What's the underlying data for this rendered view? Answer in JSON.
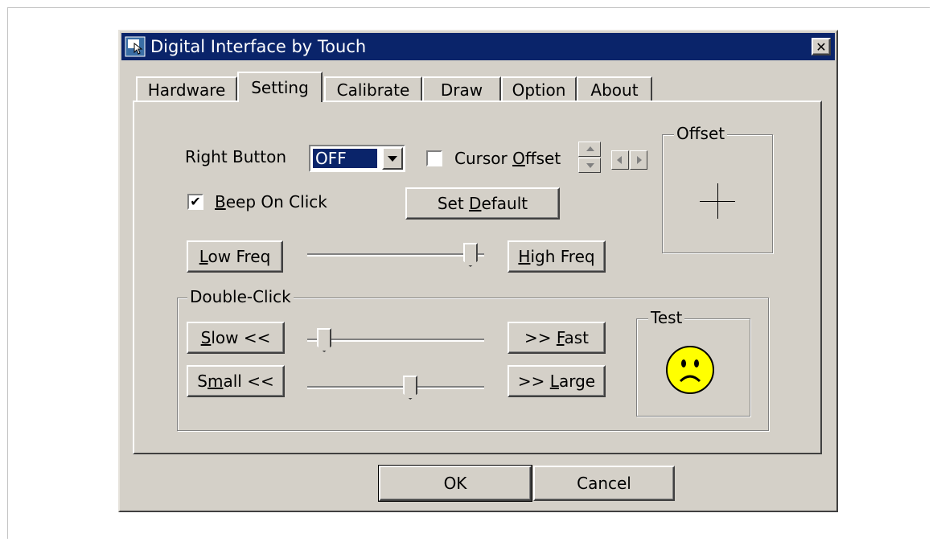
{
  "window": {
    "title": "Digital Interface by Touch",
    "close_label": "✕"
  },
  "tabs": [
    {
      "label": "Hardware",
      "active": false
    },
    {
      "label": "Setting",
      "active": true
    },
    {
      "label": "Calibrate",
      "active": false
    },
    {
      "label": "Draw",
      "active": false
    },
    {
      "label": "Option",
      "active": false
    },
    {
      "label": "About",
      "active": false
    }
  ],
  "setting": {
    "right_button_label": "Right Button",
    "right_button_value": "OFF",
    "cursor_offset_checked": false,
    "cursor_offset_pre": "Cursor ",
    "cursor_offset_key": "O",
    "cursor_offset_post": "ffset",
    "beep_checked": true,
    "beep_key": "B",
    "beep_post": "eep On Click",
    "set_default_pre": "Set ",
    "set_default_key": "D",
    "set_default_post": "efault",
    "offset_group_label": "Offset",
    "low_freq_key": "L",
    "low_freq_post": "ow Freq",
    "high_freq_key": "H",
    "high_freq_post": "igh Freq",
    "freq_slider_level": 0.96,
    "double_click": {
      "group_label": "Double-Click",
      "slow_key": "S",
      "slow_post": "low <<",
      "fast_pre": ">> ",
      "fast_key": "F",
      "fast_post": "ast",
      "small_pre": "S",
      "small_key": "m",
      "small_post": "all <<",
      "large_pre": ">> ",
      "large_key": "L",
      "large_post": "arge",
      "speed_slider_level": 0.06,
      "size_slider_level": 0.59,
      "test_group_label": "Test",
      "test_icon": "sad-face-icon"
    }
  },
  "footer": {
    "ok_label": "OK",
    "cancel_label": "Cancel"
  },
  "colors": {
    "titlebar": "#0a246a",
    "face_background": "#d4d0c8",
    "smiley": "#ffff00"
  }
}
